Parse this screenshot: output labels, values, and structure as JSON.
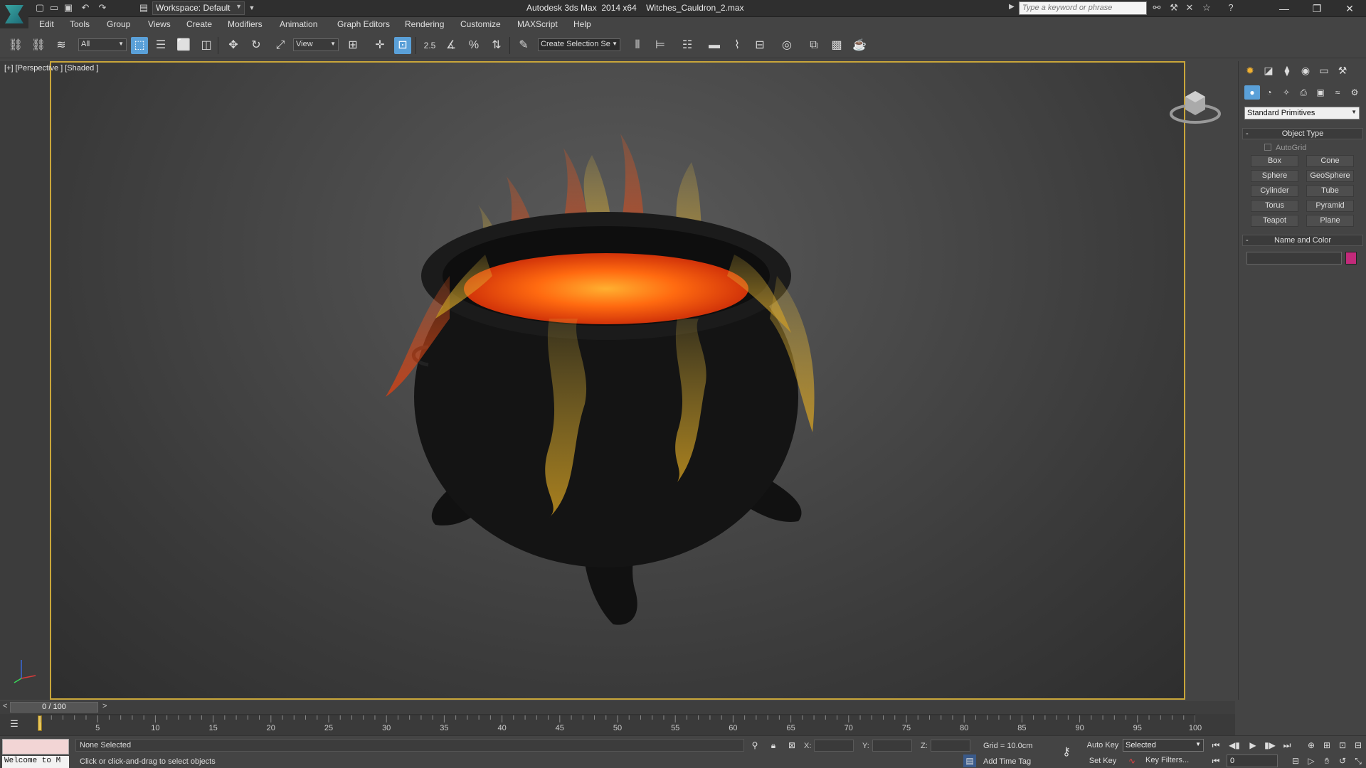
{
  "app": {
    "title": "Autodesk 3ds Max  2014 x64    Witches_Cauldron_2.max",
    "workspace": "Workspace: Default",
    "search_placeholder": "Type a keyword or phrase"
  },
  "menu": [
    "Edit",
    "Tools",
    "Group",
    "Views",
    "Create",
    "Modifiers",
    "Animation",
    "Graph Editors",
    "Rendering",
    "Customize",
    "MAXScript",
    "Help"
  ],
  "toolbar": {
    "selection_filter": "All",
    "ref_coord": "View",
    "snap_angle": "2.5",
    "named_selection": "Create Selection Se"
  },
  "viewport": {
    "label": "[+] [Perspective ] [Shaded ]"
  },
  "command_panel": {
    "category": "Standard Primitives",
    "object_type_title": "Object Type",
    "autogrid": "AutoGrid",
    "buttons": [
      "Box",
      "Cone",
      "Sphere",
      "GeoSphere",
      "Cylinder",
      "Tube",
      "Torus",
      "Pyramid",
      "Teapot",
      "Plane"
    ],
    "name_color_title": "Name and Color",
    "swatch_color": "#c22a7a",
    "minus": "-"
  },
  "timeline": {
    "frame_display": "0 / 100",
    "left_arrow": "<",
    "right_arrow": ">",
    "ticks": [
      "5",
      "10",
      "15",
      "20",
      "25",
      "30",
      "35",
      "40",
      "45",
      "50",
      "55",
      "60",
      "65",
      "70",
      "75",
      "80",
      "85",
      "90",
      "95",
      "100"
    ]
  },
  "status": {
    "welcome": "Welcome to M",
    "selection": "None Selected",
    "prompt": "Click or click-and-drag to select objects",
    "x_label": "X:",
    "y_label": "Y:",
    "z_label": "Z:",
    "grid": "Grid = 10.0cm",
    "add_time_tag": "Add Time Tag",
    "auto_key": "Auto Key",
    "set_key": "Set Key",
    "key_mode": "Selected",
    "key_filters": "Key Filters...",
    "current_frame": "0"
  },
  "colors": {
    "viewport_border": "#c9a63a",
    "active_button": "#5aa0d8"
  }
}
